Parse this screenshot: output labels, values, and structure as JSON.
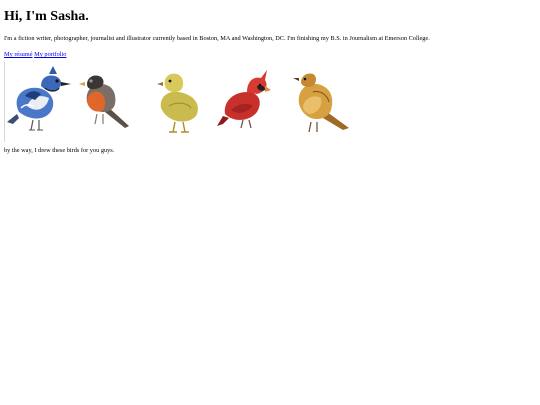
{
  "heading": "Hi, I'm Sasha.",
  "intro": "I'm a fiction writer, photographer, journalist and illustrator currently based in Boston, MA and Washington, DC. I'm finishing my B.S. in Journalism at Emerson College.",
  "links": [
    {
      "label": "My résumé"
    },
    {
      "label": "My portfolio"
    }
  ],
  "birds": [
    {
      "icon": "blue-jay-illustration"
    },
    {
      "icon": "robin-illustration"
    },
    {
      "icon": "duckling-illustration"
    },
    {
      "icon": "cardinal-illustration"
    },
    {
      "icon": "sparrow-illustration"
    }
  ],
  "note": "by the way, I drew these birds for you guys.",
  "colors": {
    "link": "#0000ee",
    "text": "#000000",
    "background": "#ffffff"
  }
}
